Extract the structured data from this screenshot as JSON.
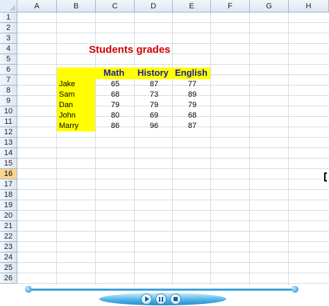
{
  "columns": [
    "A",
    "B",
    "C",
    "D",
    "E",
    "F",
    "G",
    "H"
  ],
  "rows": [
    "1",
    "2",
    "3",
    "4",
    "5",
    "6",
    "7",
    "8",
    "9",
    "10",
    "11",
    "12",
    "13",
    "14",
    "15",
    "16",
    "17",
    "18",
    "19",
    "20",
    "21",
    "22",
    "23",
    "24",
    "25",
    "26"
  ],
  "active_row": "16",
  "sheet": {
    "title": "Students grades",
    "headers": [
      "Math",
      "History",
      "English"
    ],
    "students": [
      {
        "name": "Jake",
        "math": "65",
        "history": "87",
        "english": "77"
      },
      {
        "name": "Sam",
        "math": "68",
        "history": "73",
        "english": "89"
      },
      {
        "name": "Dan",
        "math": "79",
        "history": "79",
        "english": "79"
      },
      {
        "name": "John",
        "math": "80",
        "history": "69",
        "english": "68"
      },
      {
        "name": "Marry",
        "math": "86",
        "history": "96",
        "english": "87"
      }
    ]
  },
  "colors": {
    "title": "#d00000",
    "header_text": "#1a1aa0",
    "highlight": "#ffff00"
  },
  "player": {
    "controls": [
      "play-icon",
      "pause-icon",
      "stop-icon"
    ]
  }
}
